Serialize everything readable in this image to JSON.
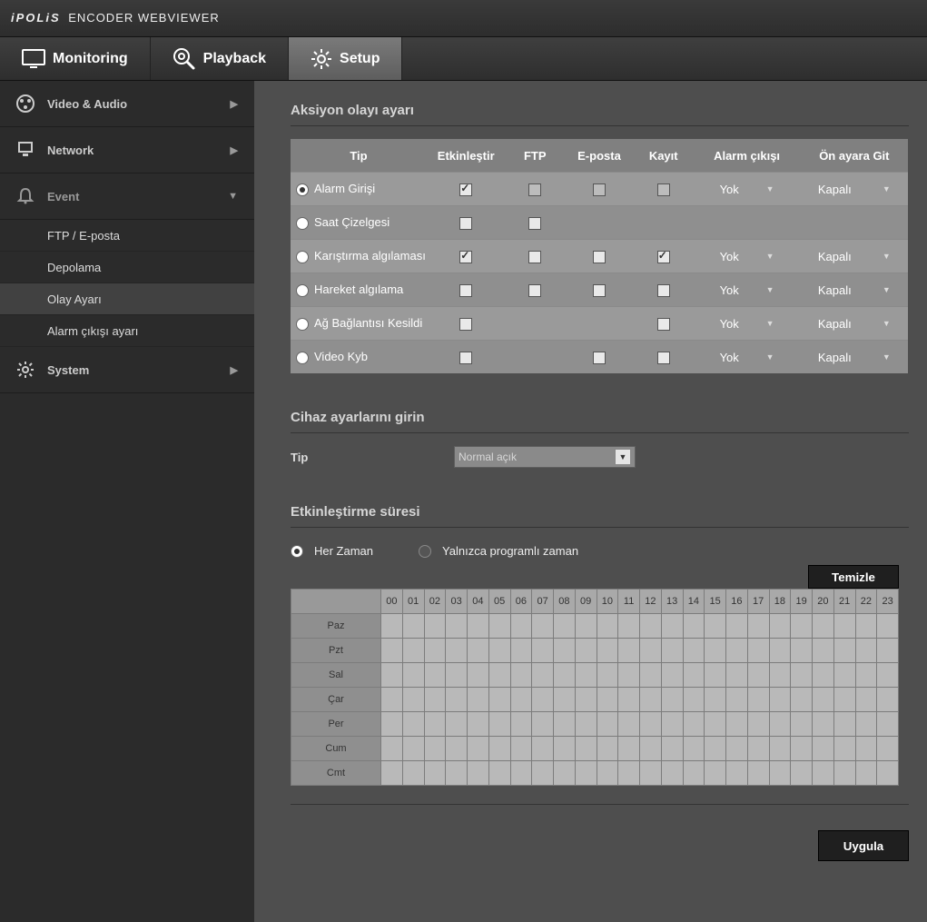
{
  "header": {
    "brand": "iPOLiS",
    "product": "ENCODER WEBVIEWER"
  },
  "tabs": {
    "monitoring": "Monitoring",
    "playback": "Playback",
    "setup": "Setup"
  },
  "sidebar": {
    "groups": [
      {
        "label": "Video & Audio"
      },
      {
        "label": "Network"
      },
      {
        "label": "Event"
      },
      {
        "label": "System"
      }
    ],
    "event_items": [
      {
        "label": "FTP / E-posta"
      },
      {
        "label": "Depolama"
      },
      {
        "label": "Olay Ayarı"
      },
      {
        "label": "Alarm çıkışı ayarı"
      }
    ]
  },
  "sections": {
    "action_event": "Aksiyon olayı ayarı",
    "device_input": "Cihaz ayarlarını girin",
    "activation": "Etkinleştirme süresi"
  },
  "event_headers": {
    "tip": "Tip",
    "enable": "Etkinleştir",
    "ftp": "FTP",
    "email": "E-posta",
    "record": "Kayıt",
    "alarm_out": "Alarm çıkışı",
    "goto_preset": "Ön ayara Git"
  },
  "events": [
    {
      "tip": "Alarm Girişi",
      "radio": true,
      "enable": true,
      "ftp": "dim",
      "email": "dim",
      "record": "dim",
      "alarm_out": "Yok",
      "preset": "Kapalı"
    },
    {
      "tip": "Saat Çizelgesi",
      "radio": false,
      "enable": false,
      "ftp": "off",
      "email": null,
      "record": null,
      "alarm_out": null,
      "preset": null
    },
    {
      "tip": "Karıştırma algılaması",
      "radio": false,
      "enable": true,
      "ftp": "off",
      "email": "off",
      "record": true,
      "alarm_out": "Yok",
      "preset": "Kapalı"
    },
    {
      "tip": "Hareket algılama",
      "radio": false,
      "enable": false,
      "ftp": "off",
      "email": "off",
      "record": "off",
      "alarm_out": "Yok",
      "preset": "Kapalı"
    },
    {
      "tip": "Ağ Bağlantısı Kesildi",
      "radio": false,
      "enable": false,
      "ftp": null,
      "email": null,
      "record": "off",
      "alarm_out": "Yok",
      "preset": "Kapalı"
    },
    {
      "tip": "Video Kyb",
      "radio": false,
      "enable": false,
      "ftp": null,
      "email": "off",
      "record": "off",
      "alarm_out": "Yok",
      "preset": "Kapalı"
    }
  ],
  "device": {
    "label": "Tip",
    "value": "Normal açık"
  },
  "activation": {
    "opt_always": "Her Zaman",
    "opt_sched": "Yalnızca programlı zaman",
    "clear": "Temizle",
    "hours": [
      "00",
      "01",
      "02",
      "03",
      "04",
      "05",
      "06",
      "07",
      "08",
      "09",
      "10",
      "11",
      "12",
      "13",
      "14",
      "15",
      "16",
      "17",
      "18",
      "19",
      "20",
      "21",
      "22",
      "23"
    ],
    "days": [
      "Paz",
      "Pzt",
      "Sal",
      "Çar",
      "Per",
      "Cum",
      "Cmt"
    ]
  },
  "apply": "Uygula"
}
